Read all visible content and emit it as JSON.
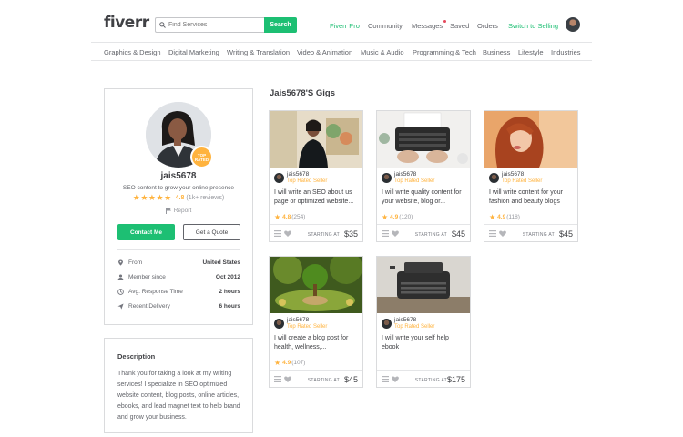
{
  "header": {
    "logo": "fiverr",
    "search_placeholder": "Find Services",
    "search_button": "Search",
    "nav": {
      "fiverr_pro": "Fiverr Pro",
      "community": "Community",
      "messages": "Messages",
      "saved": "Saved",
      "orders": "Orders",
      "switch_selling": "Switch to Selling"
    }
  },
  "categories": [
    "Graphics & Design",
    "Digital Marketing",
    "Writing & Translation",
    "Video & Animation",
    "Music & Audio",
    "Programming & Tech",
    "Business",
    "Lifestyle",
    "Industries"
  ],
  "profile": {
    "badge": "TOP RATED",
    "username": "jais5678",
    "tagline": "SEO content to grow your online presence",
    "stars": "★★★★★",
    "rating": "4.8",
    "reviews": "(1k+ reviews)",
    "report": "Report",
    "contact_button": "Contact Me",
    "quote_button": "Get a Quote",
    "stats": [
      {
        "label": "From",
        "value": "United States",
        "icon": "location-pin-icon"
      },
      {
        "label": "Member since",
        "value": "Oct 2012",
        "icon": "user-icon"
      },
      {
        "label": "Avg. Response Time",
        "value": "2 hours",
        "icon": "clock-icon"
      },
      {
        "label": "Recent Delivery",
        "value": "6 hours",
        "icon": "send-icon"
      }
    ]
  },
  "description": {
    "title": "Description",
    "text": "Thank you for taking a look at my writing services! I specialize in SEO optimized website content, blog posts, online articles, ebooks, and lead magnet text to help brand and grow your business."
  },
  "gigs_section": {
    "title": "Jais5678'S Gigs",
    "starting_at": "STARTING AT",
    "gigs": [
      {
        "seller": "jais5678",
        "level": "Top Rated Seller",
        "title": "I will write an SEO about us page or optimized website...",
        "star": "★",
        "rating": "4.8",
        "count": "(254)",
        "price": "$35"
      },
      {
        "seller": "jais5678",
        "level": "Top Rated Seller",
        "title": "I will write quality content for your website, blog or...",
        "star": "★",
        "rating": "4.9",
        "count": "(120)",
        "price": "$45"
      },
      {
        "seller": "jais5678",
        "level": "Top Rated Seller",
        "title": "I will write content for your fashion and beauty blogs",
        "star": "★",
        "rating": "4.9",
        "count": "(118)",
        "price": "$45"
      },
      {
        "seller": "jais5678",
        "level": "Top Rated Seller",
        "title": "I will create a blog post for health, wellness,...",
        "star": "★",
        "rating": "4.9",
        "count": "(107)",
        "price": "$45"
      },
      {
        "seller": "jais5678",
        "level": "Top Rated Seller",
        "title": "I will write your self help ebook",
        "star": "",
        "rating": "",
        "count": "",
        "price": "$175"
      }
    ]
  },
  "colors": {
    "brand_green": "#1dbf73",
    "star": "#ffb33e",
    "text": "#404145",
    "muted": "#62646a",
    "border": "#dadbdd"
  }
}
